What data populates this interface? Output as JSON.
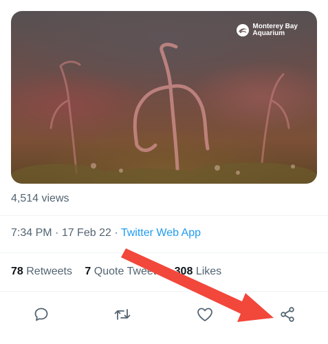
{
  "media": {
    "brand_line1": "Monterey Bay",
    "brand_line2": "Aquarium",
    "logo_icon": "monterey-bay-aquarium-logo"
  },
  "tweet": {
    "views": "4,514 views",
    "time": "7:34 PM",
    "separator": " · ",
    "date": "17 Feb 22",
    "app": "Twitter Web App"
  },
  "stats": {
    "retweets_count": "78",
    "retweets_label": "Retweets",
    "quotes_count": "7",
    "quotes_label": "Quote Tweets",
    "likes_count": "308",
    "likes_label": "Likes"
  },
  "actions": [
    {
      "name": "reply",
      "icon": "speech-bubble-icon"
    },
    {
      "name": "retweet",
      "icon": "retweet-icon"
    },
    {
      "name": "like",
      "icon": "heart-icon"
    },
    {
      "name": "share",
      "icon": "share-icon"
    }
  ],
  "colors": {
    "text_primary": "#0f1419",
    "text_secondary": "#536471",
    "link": "#1d9bf0",
    "annotation_arrow": "#f2473b"
  }
}
